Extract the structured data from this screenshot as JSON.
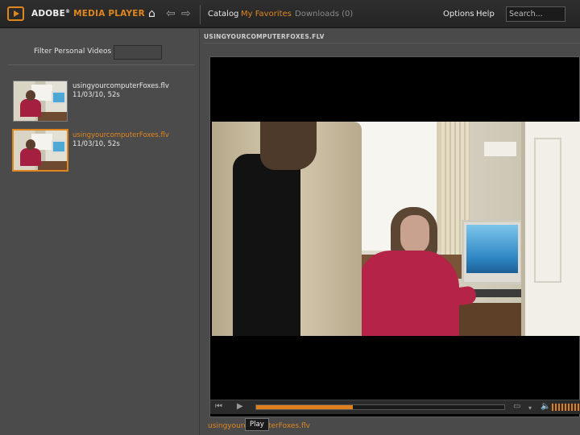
{
  "app": {
    "brand_primary": "ADOBE",
    "brand_mark": "®",
    "brand_secondary": "MEDIA PLAYER",
    "accent_color": "#e0861f"
  },
  "icons": {
    "logo": "play-logo-icon",
    "home": "home-icon",
    "back": "back-arrow-icon",
    "forward": "forward-arrow-icon"
  },
  "nav": {
    "catalog": "Catalog",
    "favorites": "My Favorites",
    "downloads": "Downloads (0)",
    "options": "Options",
    "help": "Help",
    "active": "My Favorites"
  },
  "search": {
    "placeholder": "Search..."
  },
  "sidebar": {
    "filter_label": "Filter Personal Videos",
    "filter_value": "",
    "items": [
      {
        "title": "usingyourcomputerFoxes.flv",
        "meta": "11/03/10, 52s",
        "selected": false
      },
      {
        "title": "usingyourcomputerFoxes.flv",
        "meta": "11/03/10, 52s",
        "selected": true
      }
    ]
  },
  "player": {
    "now_playing_title": "USINGYOURCOMPUTERFOXES.FLV",
    "progress_fraction": 0.39,
    "volume_fraction": 1.0,
    "caption_filename": "usingyourcomputerFoxes.flv",
    "tooltip": "Play"
  }
}
